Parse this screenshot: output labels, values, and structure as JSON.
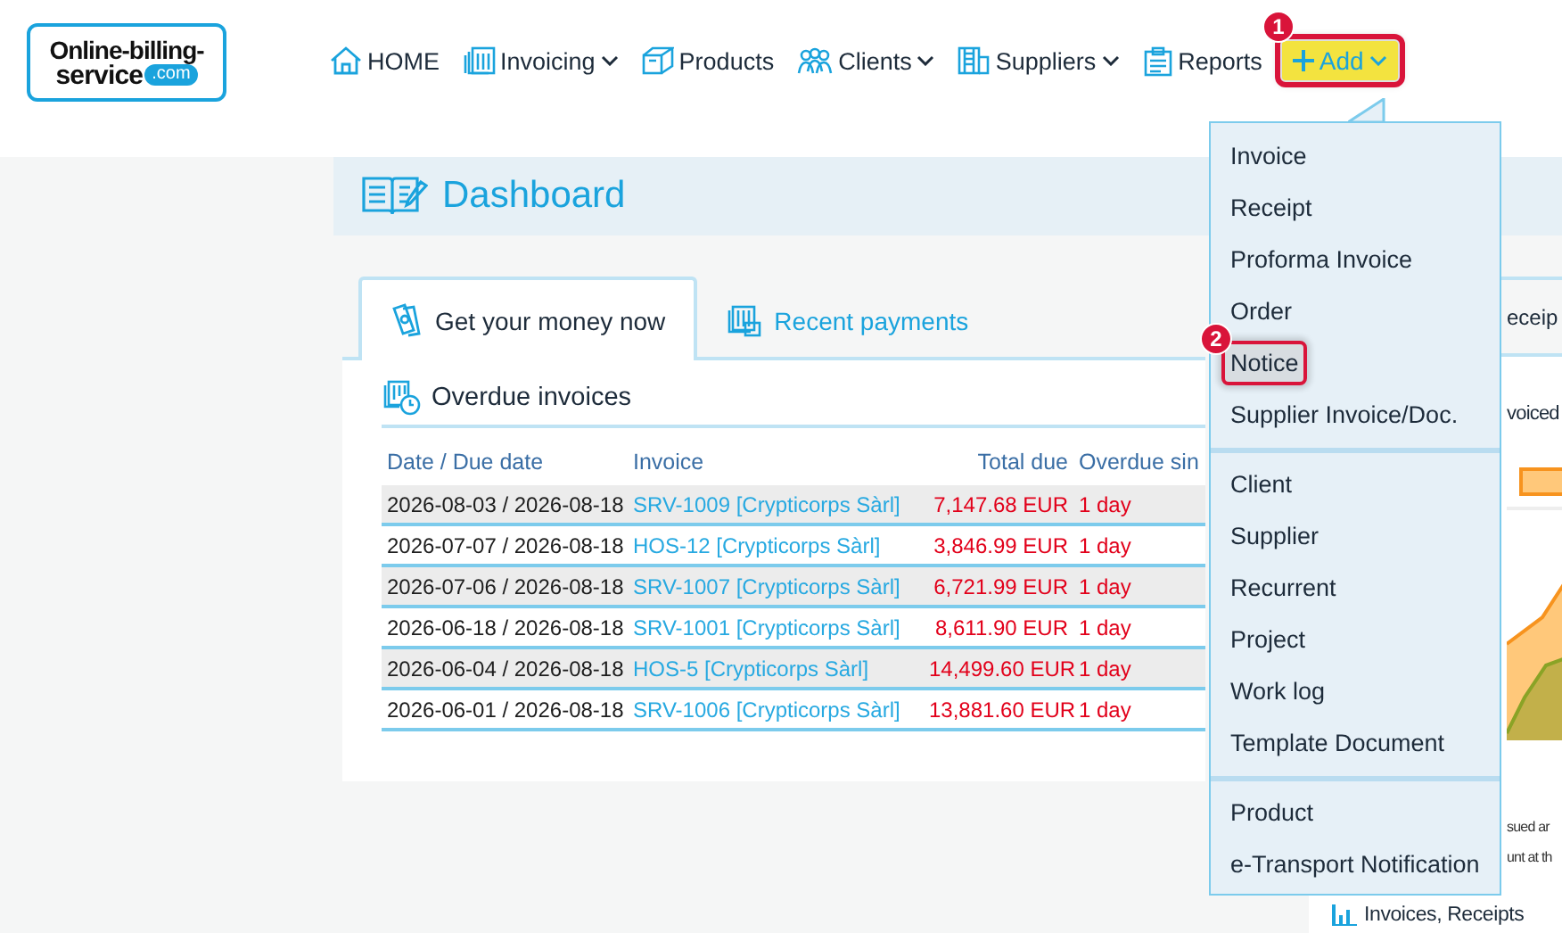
{
  "logo": {
    "lines": [
      "Online-billing-",
      "service"
    ],
    "domain": ".com"
  },
  "nav": [
    {
      "label": "HOME",
      "dropdown": false,
      "kind": "link"
    },
    {
      "label": "Invoicing",
      "dropdown": true,
      "kind": "link"
    },
    {
      "label": "Products",
      "dropdown": false,
      "kind": "link"
    },
    {
      "label": "Clients",
      "dropdown": true,
      "kind": "link"
    },
    {
      "label": "Suppliers",
      "dropdown": true,
      "kind": "link"
    },
    {
      "label": "Reports",
      "dropdown": false,
      "kind": "link"
    },
    {
      "label": "Add",
      "dropdown": true,
      "kind": "add",
      "annotation": "1"
    }
  ],
  "page_title": "Dashboard",
  "left_panel": {
    "tabs": [
      {
        "label": "Get your money now",
        "selected": true
      },
      {
        "label": "Recent payments",
        "selected": false
      }
    ],
    "section_title": "Overdue invoices",
    "table": {
      "columns": [
        "Date / Due date",
        "Invoice",
        "Total due",
        "Overdue sin"
      ],
      "rows": [
        {
          "date": "2026-08-03 / 2026-08-18",
          "invoice": "SRV-1009 [Crypticorps Sàrl]",
          "total_due": "7,147.68 EUR",
          "overdue_since": "1 day"
        },
        {
          "date": "2026-07-07 / 2026-08-18",
          "invoice": "HOS-12 [Crypticorps Sàrl]",
          "total_due": "3,846.99 EUR",
          "overdue_since": "1 day"
        },
        {
          "date": "2026-07-06 / 2026-08-18",
          "invoice": "SRV-1007 [Crypticorps Sàrl]",
          "total_due": "6,721.99 EUR",
          "overdue_since": "1 day"
        },
        {
          "date": "2026-06-18 / 2026-08-18",
          "invoice": "SRV-1001 [Crypticorps Sàrl]",
          "total_due": "8,611.90 EUR",
          "overdue_since": "1 day"
        },
        {
          "date": "2026-06-04 / 2026-08-18",
          "invoice": "HOS-5 [Crypticorps Sàrl]",
          "total_due": "14,499.60 EUR",
          "overdue_since": "1 day"
        },
        {
          "date": "2026-06-01 / 2026-08-18",
          "invoice": "SRV-1006 [Crypticorps Sàrl]",
          "total_due": "13,881.60 EUR",
          "overdue_since": "1 day"
        }
      ]
    }
  },
  "right_panel": {
    "tab": "eceip",
    "heading": "voiced",
    "note_lines": [
      "sued ar",
      "unt at th"
    ],
    "section_title": "Invoices, Receipts"
  },
  "add_menu": {
    "groups": [
      [
        {
          "label": "Invoice",
          "selected": false
        },
        {
          "label": "Receipt",
          "selected": false
        },
        {
          "label": "Proforma Invoice",
          "selected": false
        },
        {
          "label": "Order",
          "selected": false
        },
        {
          "label": "Notice",
          "selected": true,
          "annotation": "2"
        },
        {
          "label": "Supplier Invoice/Doc.",
          "selected": false
        }
      ],
      [
        {
          "label": "Client",
          "selected": false
        },
        {
          "label": "Supplier",
          "selected": false
        },
        {
          "label": "Recurrent",
          "selected": false
        },
        {
          "label": "Project",
          "selected": false
        },
        {
          "label": "Work log",
          "selected": false
        },
        {
          "label": "Template Document",
          "selected": false
        }
      ],
      [
        {
          "label": "Product",
          "selected": false
        },
        {
          "label": "e-Transport Notification",
          "selected": false
        }
      ]
    ]
  }
}
